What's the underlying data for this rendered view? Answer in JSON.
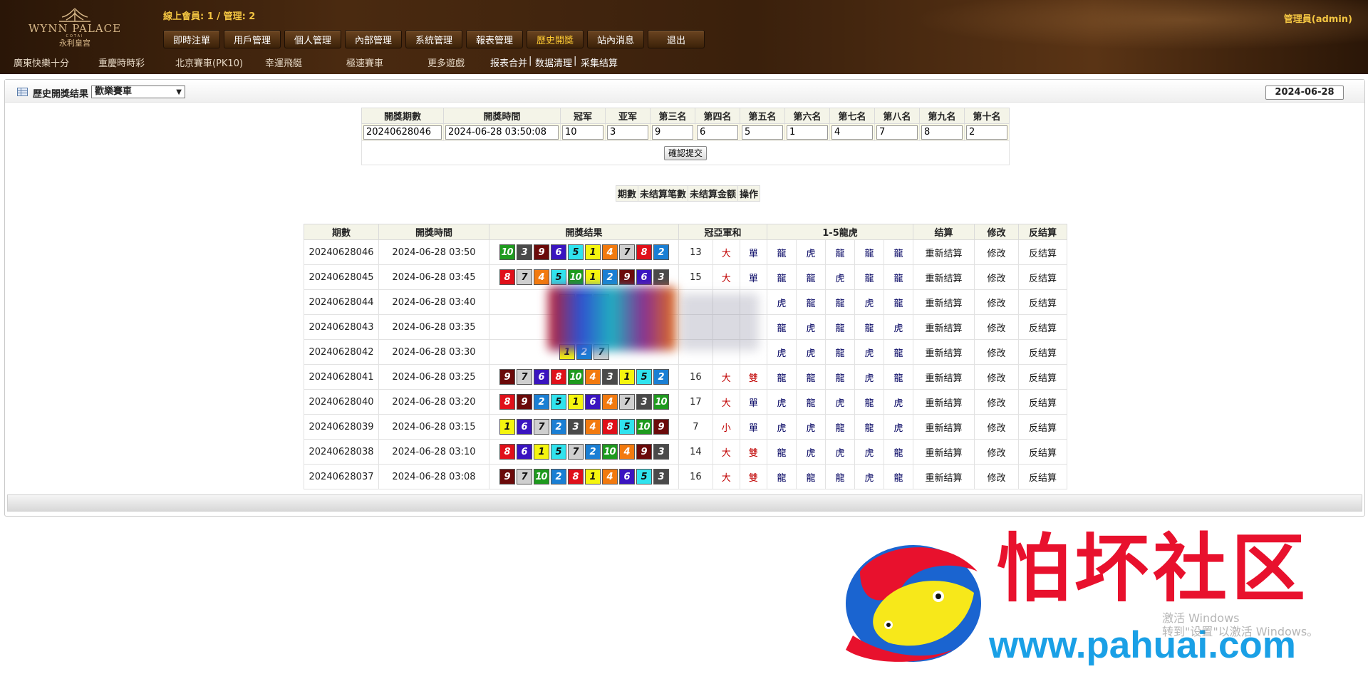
{
  "header": {
    "logo": {
      "name": "WYNN PALACE",
      "sub": "COTAI",
      "cn": "永利皇宫"
    },
    "online_text": "線上會員: 1 / 管理: 2",
    "admin_text": "管理員(admin)",
    "nav": [
      "即時注單",
      "用戶管理",
      "個人管理",
      "內部管理",
      "系統管理",
      "報表管理",
      "歷史開獎",
      "站內消息",
      "退出"
    ],
    "nav_active_index": 6,
    "games": [
      "廣東快樂十分",
      "重慶時時彩",
      "北京賽車(PK10)",
      "幸運飛艇",
      "極速賽車",
      "更多遊戲"
    ],
    "tools": [
      "报表合并",
      "|",
      "数据清理",
      "|",
      "采集结算"
    ]
  },
  "panel": {
    "title": "歷史開獎结果",
    "game_selected": "歡樂賽車",
    "date": "2024-06-28"
  },
  "entry_form": {
    "headers": [
      "開獎期數",
      "開獎時間",
      "冠军",
      "亚军",
      "第三名",
      "第四名",
      "第五名",
      "第六名",
      "第七名",
      "第八名",
      "第九名",
      "第十名"
    ],
    "values": [
      "20240628046",
      "2024-06-28 03:50:08",
      "10",
      "3",
      "9",
      "6",
      "5",
      "1",
      "4",
      "7",
      "8",
      "2"
    ],
    "submit_label": "確認提交"
  },
  "pending_table": {
    "headers": [
      "期數",
      "未结算笔數",
      "未结算金额",
      "操作"
    ]
  },
  "history": {
    "headers": [
      "期數",
      "開獎時間",
      "開獎结果",
      "冠亞軍和",
      "1-5龍虎",
      "结算",
      "修改",
      "反结算"
    ],
    "resettle_label": "重新结算",
    "modify_label": "修改",
    "unsettle_label": "反结算",
    "ball_colors": {
      "1": "#f5f50f",
      "2": "#1a7fd4",
      "3": "#4a4a4a",
      "4": "#f27a0f",
      "5": "#30e3ee",
      "6": "#3a14c0",
      "7": "#cfcfcf",
      "8": "#e0101a",
      "9": "#6b0a0a",
      "10": "#1e9a1e"
    },
    "rows": [
      {
        "issue": "20240628046",
        "time": "2024-06-28 03:50",
        "balls": [
          10,
          3,
          9,
          6,
          5,
          1,
          4,
          7,
          8,
          2
        ],
        "sum": "13",
        "size": "大",
        "parity": "單",
        "lh": [
          "龍",
          "虎",
          "龍",
          "龍",
          "龍"
        ]
      },
      {
        "issue": "20240628045",
        "time": "2024-06-28 03:45",
        "balls": [
          8,
          7,
          4,
          5,
          10,
          1,
          2,
          9,
          6,
          3
        ],
        "sum": "15",
        "size": "大",
        "parity": "單",
        "lh": [
          "龍",
          "龍",
          "虎",
          "龍",
          "龍"
        ]
      },
      {
        "issue": "20240628044",
        "time": "2024-06-28 03:40",
        "balls": [
          1,
          6,
          4
        ],
        "sum": "",
        "size": "",
        "parity": "",
        "lh": [
          "虎",
          "龍",
          "龍",
          "虎",
          "龍"
        ],
        "blurred": true
      },
      {
        "issue": "20240628043",
        "time": "2024-06-28 03:35",
        "balls": [
          2,
          3,
          9
        ],
        "sum": "",
        "size": "",
        "parity": "",
        "lh": [
          "龍",
          "虎",
          "龍",
          "龍",
          "虎"
        ],
        "blurred": true
      },
      {
        "issue": "20240628042",
        "time": "2024-06-28 03:30",
        "balls": [
          1,
          2,
          7
        ],
        "sum": "",
        "size": "",
        "parity": "",
        "lh": [
          "虎",
          "虎",
          "龍",
          "虎",
          "龍"
        ],
        "blurred": true
      },
      {
        "issue": "20240628041",
        "time": "2024-06-28 03:25",
        "balls": [
          9,
          7,
          6,
          8,
          10,
          4,
          3,
          1,
          5,
          2
        ],
        "sum": "16",
        "size": "大",
        "parity": "雙",
        "lh": [
          "龍",
          "龍",
          "龍",
          "虎",
          "龍"
        ]
      },
      {
        "issue": "20240628040",
        "time": "2024-06-28 03:20",
        "balls": [
          8,
          9,
          2,
          5,
          1,
          6,
          4,
          7,
          3,
          10
        ],
        "sum": "17",
        "size": "大",
        "parity": "單",
        "lh": [
          "虎",
          "龍",
          "虎",
          "龍",
          "虎"
        ]
      },
      {
        "issue": "20240628039",
        "time": "2024-06-28 03:15",
        "balls": [
          1,
          6,
          7,
          2,
          3,
          4,
          8,
          5,
          10,
          9
        ],
        "sum": "7",
        "size": "小",
        "parity": "單",
        "lh": [
          "虎",
          "虎",
          "龍",
          "龍",
          "虎"
        ]
      },
      {
        "issue": "20240628038",
        "time": "2024-06-28 03:10",
        "balls": [
          8,
          6,
          1,
          5,
          7,
          2,
          10,
          4,
          9,
          3
        ],
        "sum": "14",
        "size": "大",
        "parity": "雙",
        "lh": [
          "龍",
          "虎",
          "虎",
          "虎",
          "龍"
        ]
      },
      {
        "issue": "20240628037",
        "time": "2024-06-28 03:08",
        "balls": [
          9,
          7,
          10,
          2,
          8,
          1,
          4,
          6,
          5,
          3
        ],
        "sum": "16",
        "size": "大",
        "parity": "雙",
        "lh": [
          "龍",
          "龍",
          "龍",
          "虎",
          "龍"
        ]
      }
    ]
  },
  "watermark": {
    "title": "怕坏社区",
    "url": "www.pahuai.com",
    "win_line1": "激活 Windows",
    "win_line2": "转到\"设置\"以激活 Windows。"
  }
}
